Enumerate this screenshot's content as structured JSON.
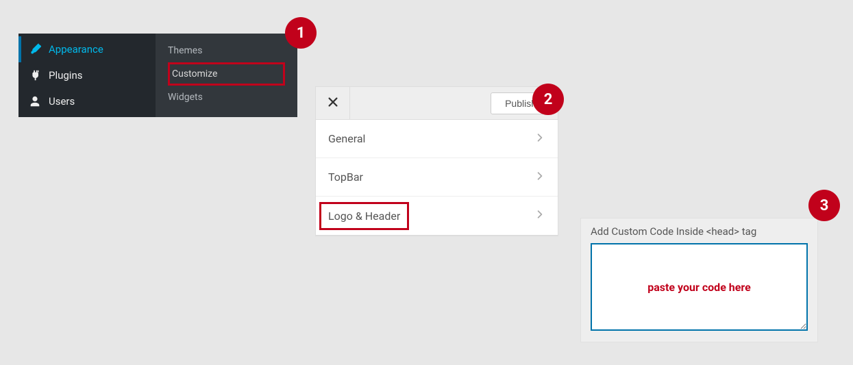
{
  "steps": {
    "one": "1",
    "two": "2",
    "three": "3"
  },
  "sidebar": {
    "items": [
      {
        "label": "Appearance"
      },
      {
        "label": "Plugins"
      },
      {
        "label": "Users"
      }
    ],
    "flyout": [
      {
        "label": "Themes"
      },
      {
        "label": "Customize"
      },
      {
        "label": "Widgets"
      }
    ]
  },
  "customizer": {
    "publish_label": "Publish",
    "rows": [
      {
        "label": "General"
      },
      {
        "label": "TopBar"
      },
      {
        "label": "Logo & Header"
      }
    ]
  },
  "codebox": {
    "title": "Add Custom Code Inside <head> tag",
    "placeholder": "paste your code here",
    "value": ""
  }
}
